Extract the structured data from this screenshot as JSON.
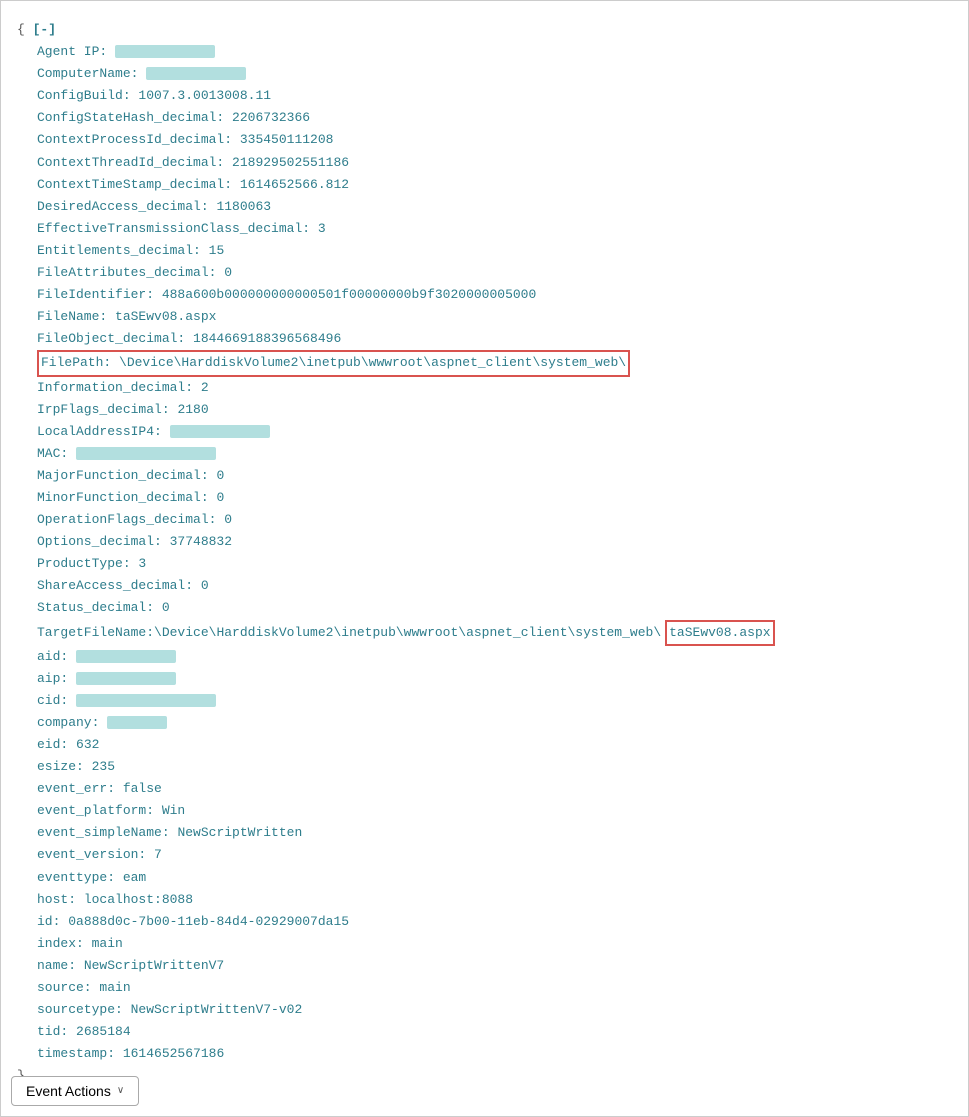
{
  "header": {
    "open_brace": "{",
    "minus_bracket": "[-]",
    "close_brace": "}"
  },
  "fields": [
    {
      "key": "Agent IP:",
      "value": null,
      "redacted": true,
      "redacted_size": "med"
    },
    {
      "key": "ComputerName:",
      "value": null,
      "redacted": true,
      "redacted_size": "med"
    },
    {
      "key": "ConfigBuild:",
      "value": "1007.3.0013008.11",
      "redacted": false
    },
    {
      "key": "ConfigStateHash_decimal:",
      "value": "2206732366",
      "redacted": false
    },
    {
      "key": "ContextProcessId_decimal:",
      "value": "335450111208",
      "redacted": false
    },
    {
      "key": "ContextThreadId_decimal:",
      "value": "218929502551186",
      "redacted": false
    },
    {
      "key": "ContextTimeStamp_decimal:",
      "value": "1614652566.812",
      "redacted": false
    },
    {
      "key": "DesiredAccess_decimal:",
      "value": "1180063",
      "redacted": false
    },
    {
      "key": "EffectiveTransmissionClass_decimal:",
      "value": "3",
      "redacted": false
    },
    {
      "key": "Entitlements_decimal:",
      "value": "15",
      "redacted": false
    },
    {
      "key": "FileAttributes_decimal:",
      "value": "0",
      "redacted": false
    },
    {
      "key": "FileIdentifier:",
      "value": "488a600b000000000000501f00000000b9f3020000005000",
      "redacted": false
    },
    {
      "key": "FileName:",
      "value": "taSEwv08.aspx",
      "redacted": false
    },
    {
      "key": "FileObject_decimal:",
      "value": "1844669188396568496",
      "redacted": false
    },
    {
      "key": "FilePath:",
      "value": "\\Device\\HarddiskVolume2\\inetpub\\wwwroot\\aspnet_client\\system_web\\",
      "redacted": false,
      "highlight": true
    },
    {
      "key": "Information_decimal:",
      "value": "2",
      "redacted": false
    },
    {
      "key": "IrpFlags_decimal:",
      "value": "2180",
      "redacted": false
    },
    {
      "key": "LocalAddressIP4:",
      "value": null,
      "redacted": true,
      "redacted_size": "med"
    },
    {
      "key": "MAC:",
      "value": null,
      "redacted": true,
      "redacted_size": "wide"
    },
    {
      "key": "MajorFunction_decimal:",
      "value": "0",
      "redacted": false
    },
    {
      "key": "MinorFunction_decimal:",
      "value": "0",
      "redacted": false
    },
    {
      "key": "OperationFlags_decimal:",
      "value": "0",
      "redacted": false
    },
    {
      "key": "Options_decimal:",
      "value": "37748832",
      "redacted": false
    },
    {
      "key": "ProductType:",
      "value": "3",
      "redacted": false
    },
    {
      "key": "ShareAccess_decimal:",
      "value": "0",
      "redacted": false
    },
    {
      "key": "Status_decimal:",
      "value": "0",
      "redacted": false
    },
    {
      "key": "TargetFileName:",
      "value": "\\Device\\HarddiskVolume2\\inetpub\\wwwroot\\aspnet_client\\system_web\\",
      "redacted": false,
      "highlight_tag": "taSEwv08.aspx",
      "special": "targetfilename"
    },
    {
      "key": "aid:",
      "value": null,
      "redacted": true,
      "redacted_size": "med"
    },
    {
      "key": "aip:",
      "value": null,
      "redacted": true,
      "redacted_size": "med"
    },
    {
      "key": "cid:",
      "value": null,
      "redacted": true,
      "redacted_size": "wide"
    },
    {
      "key": "company:",
      "value": null,
      "redacted": true,
      "redacted_size": "small"
    },
    {
      "key": "eid:",
      "value": "632",
      "redacted": false
    },
    {
      "key": "esize:",
      "value": "235",
      "redacted": false
    },
    {
      "key": "event_err:",
      "value": "false",
      "redacted": false
    },
    {
      "key": "event_platform:",
      "value": "Win",
      "redacted": false
    },
    {
      "key": "event_simpleName:",
      "value": "NewScriptWritten",
      "redacted": false
    },
    {
      "key": "event_version:",
      "value": "7",
      "redacted": false
    },
    {
      "key": "eventtype:",
      "value": "eam",
      "redacted": false
    },
    {
      "key": "host:",
      "value": "localhost:8088",
      "redacted": false
    },
    {
      "key": "id:",
      "value": "0a888d0c-7b00-11eb-84d4-02929007da15",
      "redacted": false
    },
    {
      "key": "index:",
      "value": "main",
      "redacted": false
    },
    {
      "key": "name:",
      "value": "NewScriptWrittenV7",
      "redacted": false
    },
    {
      "key": "source:",
      "value": "main",
      "redacted": false
    },
    {
      "key": "sourcetype:",
      "value": "NewScriptWrittenV7-v02",
      "redacted": false
    },
    {
      "key": "tid:",
      "value": "2685184",
      "redacted": false
    },
    {
      "key": "timestamp:",
      "value": "1614652567186",
      "redacted": false
    }
  ],
  "bottom_button": {
    "label": "Event Actions",
    "chevron": "∨"
  }
}
